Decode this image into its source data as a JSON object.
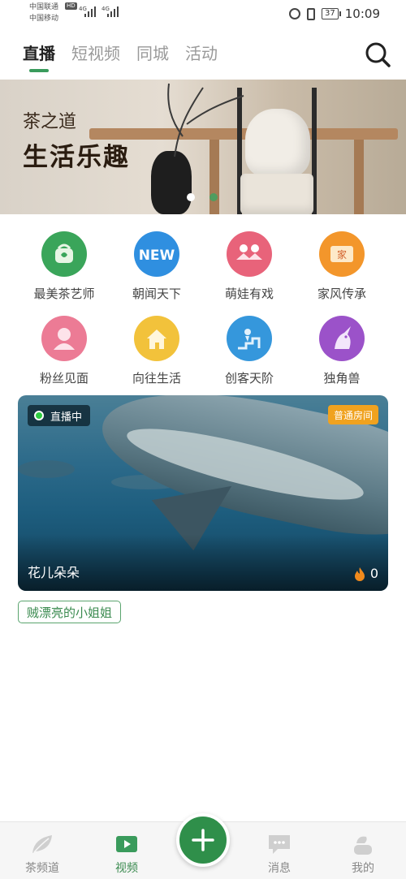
{
  "status_bar": {
    "carrier1": "中国联通",
    "hd": "HD",
    "carrier2": "中国移动",
    "signal_label1": "4G",
    "signal_label2": "4G",
    "battery": "37",
    "time": "10:09"
  },
  "top_tabs": [
    {
      "label": "直播",
      "active": true
    },
    {
      "label": "短视频",
      "active": false
    },
    {
      "label": "同城",
      "active": false
    },
    {
      "label": "活动",
      "active": false
    }
  ],
  "banner": {
    "subtitle": "茶之道",
    "title": "生活乐趣",
    "page_count": 2,
    "active_page": 1
  },
  "categories": [
    {
      "label": "最美茶艺师",
      "icon": "teapot-icon",
      "color": "#3aa55a"
    },
    {
      "label": "朝闻天下",
      "icon": "new-badge-icon",
      "color": "#2f8fe0"
    },
    {
      "label": "萌娃有戏",
      "icon": "kids-icon",
      "color": "#e8637a"
    },
    {
      "label": "家风传承",
      "icon": "scroll-icon",
      "color": "#f3962b"
    },
    {
      "label": "粉丝见面",
      "icon": "fans-icon",
      "color": "#ec7b95"
    },
    {
      "label": "向往生活",
      "icon": "house-icon",
      "color": "#f2c23b"
    },
    {
      "label": "创客天阶",
      "icon": "stairs-icon",
      "color": "#3597dc"
    },
    {
      "label": "独角兽",
      "icon": "unicorn-icon",
      "color": "#9b52c9"
    }
  ],
  "live_card": {
    "status": "直播中",
    "room_type": "普通房间",
    "title": "花儿朵朵",
    "heat": "0",
    "host": "贼漂亮的小姐姐"
  },
  "bottom_nav": [
    {
      "label": "茶频道",
      "icon": "leaf-icon",
      "active": false
    },
    {
      "label": "视频",
      "icon": "video-icon",
      "active": true
    },
    {
      "label": "消息",
      "icon": "message-icon",
      "active": false
    },
    {
      "label": "我的",
      "icon": "profile-icon",
      "active": false
    }
  ],
  "colors": {
    "accent": "#3a9b5c",
    "fab": "#2f8f4a",
    "badge_orange": "#f0a21f"
  }
}
